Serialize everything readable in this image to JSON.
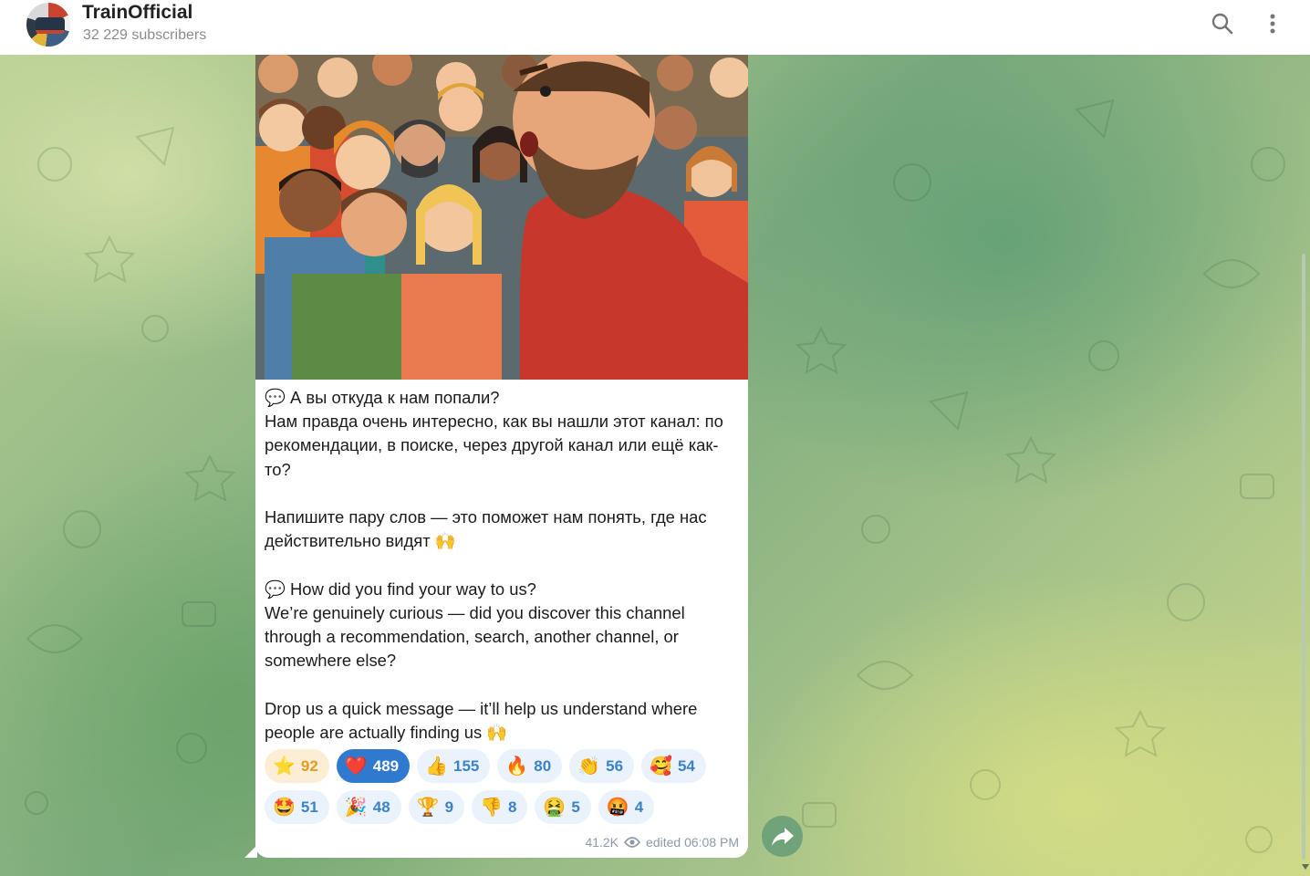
{
  "header": {
    "channel_name": "TrainOfficial",
    "subscribers": "32 229 subscribers"
  },
  "message": {
    "text": "💬 А вы откуда к нам попали?\nНам правда очень интересно, как вы нашли этот канал: по рекомендации, в поиске, через другой канал или ещё как-то?\n\nНапишите пару слов — это поможет нам понять, где нас действительно видят 🙌\n\n💬 How did you find your way to us?\nWe’re genuinely curious — did you discover this channel through a recommendation, search, another channel, or somewhere else?\n\nDrop us a quick message — it’ll help us understand where people are actually finding us 🙌",
    "views": "41.2K",
    "edited": "edited 06:08 PM"
  },
  "reactions": {
    "row1": [
      {
        "emoji": "⭐",
        "count": "92",
        "kind": "stars"
      },
      {
        "emoji": "❤️",
        "count": "489",
        "kind": "active"
      },
      {
        "emoji": "👍",
        "count": "155",
        "kind": "normal"
      },
      {
        "emoji": "🔥",
        "count": "80",
        "kind": "normal"
      },
      {
        "emoji": "👏",
        "count": "56",
        "kind": "normal"
      },
      {
        "emoji": "🥰",
        "count": "54",
        "kind": "normal"
      }
    ],
    "row2": [
      {
        "emoji": "🤩",
        "count": "51",
        "kind": "normal"
      },
      {
        "emoji": "🎉",
        "count": "48",
        "kind": "normal"
      },
      {
        "emoji": "🏆",
        "count": "9",
        "kind": "normal"
      },
      {
        "emoji": "👎",
        "count": "8",
        "kind": "normal"
      },
      {
        "emoji": "🤮",
        "count": "5",
        "kind": "normal"
      },
      {
        "emoji": "🤬",
        "count": "4",
        "kind": "normal"
      }
    ]
  },
  "colors": {
    "accent": "#2f79cf",
    "reaction_bg": "#eaf2fb",
    "reaction_text": "#3b82c8",
    "stars_bg": "#fbeed4",
    "forward_button": "#70a37a"
  },
  "icons": {
    "search": "search-icon",
    "more": "more-vertical-icon",
    "views": "eye-icon",
    "forward": "forward-arrow-icon"
  }
}
